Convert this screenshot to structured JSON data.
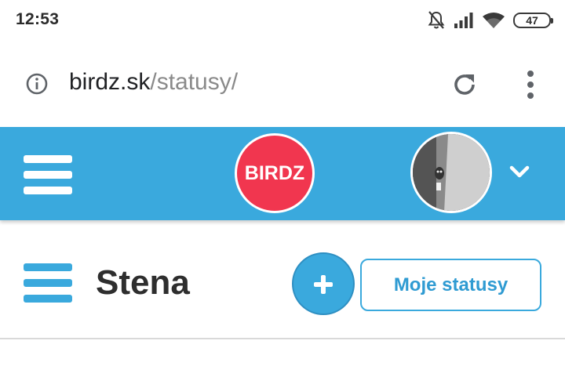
{
  "status_bar": {
    "time": "12:53",
    "battery": "47",
    "icons": [
      "mute-icon",
      "signal-icon",
      "wifi-icon",
      "battery-icon"
    ]
  },
  "browser": {
    "url_domain": "birdz.sk",
    "url_path": "/statusy/",
    "icons": [
      "info-icon",
      "reload-icon",
      "more-vert-icon"
    ]
  },
  "site_header": {
    "logo_text": "BIRDZ",
    "accent_color": "#3aa9dd",
    "logo_color": "#f1364f",
    "icons": [
      "hamburger-menu-icon",
      "chevron-down-icon",
      "avatar"
    ]
  },
  "page": {
    "title": "Stena",
    "my_statuses_label": "Moje statusy",
    "icons": [
      "hamburger-menu-icon",
      "plus-icon"
    ]
  }
}
